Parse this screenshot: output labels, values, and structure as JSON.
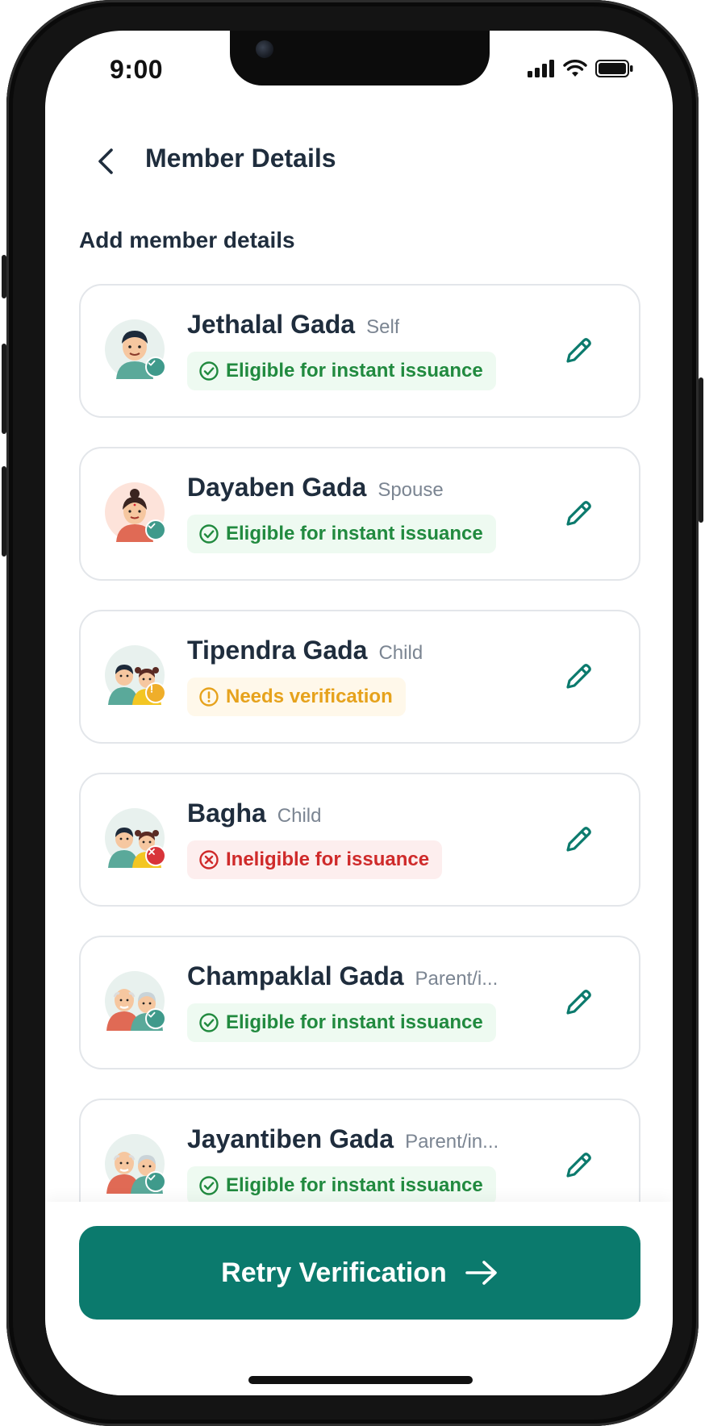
{
  "status_bar": {
    "time": "9:00"
  },
  "header": {
    "title": "Member Details"
  },
  "section": {
    "title": "Add member details"
  },
  "members": [
    {
      "name": "Jethalal Gada",
      "relation": "Self",
      "status": "Eligible for instant issuance",
      "status_type": "eligible"
    },
    {
      "name": "Dayaben Gada",
      "relation": "Spouse",
      "status": "Eligible for instant issuance",
      "status_type": "eligible"
    },
    {
      "name": "Tipendra Gada",
      "relation": "Child",
      "status": "Needs verification",
      "status_type": "warning"
    },
    {
      "name": "Bagha",
      "relation": "Child",
      "status": "Ineligible for issuance",
      "status_type": "error"
    },
    {
      "name": "Champaklal Gada",
      "relation": "Parent/i...",
      "status": "Eligible for instant issuance",
      "status_type": "eligible"
    },
    {
      "name": "Jayantiben Gada",
      "relation": "Parent/in...",
      "status": "Eligible for instant issuance",
      "status_type": "eligible"
    }
  ],
  "footer": {
    "cta_label": "Retry Verification"
  },
  "colors": {
    "primary": "#0b7a6d",
    "eligible": "#218a3f",
    "warning": "#e6a21c",
    "error": "#cf2a2a",
    "text_dark": "#1f2d3d"
  },
  "icons": {
    "back": "chevron-left-icon",
    "edit": "pencil-icon",
    "eligible": "check-circle-icon",
    "warning": "alert-circle-icon",
    "error": "x-circle-icon",
    "cta": "arrow-right-icon"
  }
}
